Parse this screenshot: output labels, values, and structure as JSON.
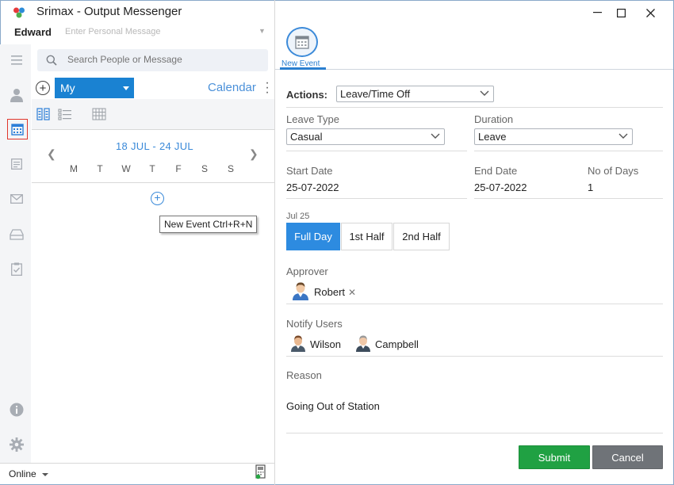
{
  "app": {
    "title": "Srimax - Output Messenger",
    "user_name": "Edward",
    "personal_message_placeholder": "Enter Personal Message"
  },
  "sidebar": {
    "icons": [
      "menu-icon",
      "contacts-icon",
      "calendar-icon",
      "notes-icon",
      "mail-icon",
      "drive-icon",
      "tasks-icon",
      "info-icon",
      "settings-icon"
    ],
    "active": "calendar-icon"
  },
  "search": {
    "placeholder": "Search People or Message"
  },
  "calendar_panel": {
    "scope_select": "My",
    "calendar_label": "Calendar",
    "week_range": "18 JUL - 24 JUL",
    "weekdays": [
      "M",
      "T",
      "W",
      "T",
      "F",
      "S",
      "S"
    ],
    "tooltip": "New Event Ctrl+R+N"
  },
  "status": {
    "presence": "Online"
  },
  "event_form": {
    "tab_label": "New Event",
    "actions_label": "Actions:",
    "actions_value": "Leave/Time Off",
    "leave_type_label": "Leave Type",
    "leave_type_value": "Casual",
    "duration_label": "Duration",
    "duration_value": "Leave",
    "start_date_label": "Start Date",
    "start_date_value": "25-07-2022",
    "end_date_label": "End Date",
    "end_date_value": "25-07-2022",
    "no_of_days_label": "No of Days",
    "no_of_days_value": "1",
    "day_label": "Jul 25",
    "half_options": [
      "Full Day",
      "1st Half",
      "2nd Half"
    ],
    "half_selected": "Full Day",
    "approver_label": "Approver",
    "approver_name": "Robert",
    "notify_label": "Notify Users",
    "notify_users": [
      "Wilson",
      "Campbell"
    ],
    "reason_label": "Reason",
    "reason_value": "Going Out of Station",
    "submit_label": "Submit",
    "cancel_label": "Cancel"
  },
  "colors": {
    "accent_blue": "#2d8be0",
    "submit_green": "#20a143",
    "cancel_gray": "#6f7378",
    "active_icon_border": "#e0352b"
  }
}
